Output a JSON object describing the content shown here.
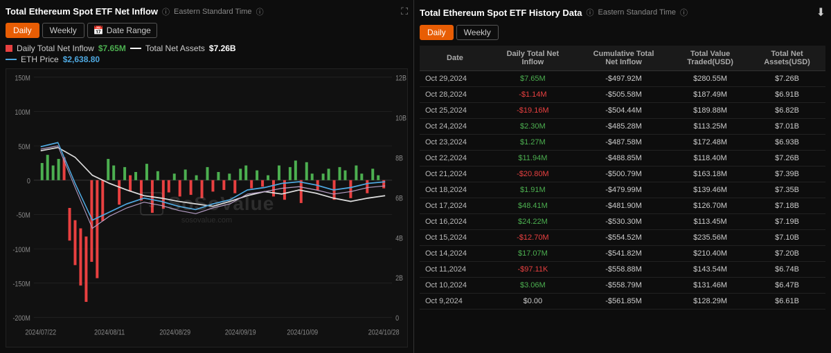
{
  "left": {
    "title": "Total Ethereum Spot ETF Net Inflow",
    "timezone": "Eastern Standard Time",
    "tabs": [
      "Daily",
      "Weekly"
    ],
    "active_tab": "Daily",
    "date_range_label": "Date Range",
    "legend": {
      "net_inflow_label": "Daily Total Net Inflow",
      "net_inflow_value": "$7.65M",
      "net_assets_label": "Total Net Assets",
      "net_assets_value": "$7.26B",
      "eth_price_label": "ETH Price",
      "eth_price_value": "$2,638.80"
    },
    "y_axis_left": [
      "150M",
      "100M",
      "50M",
      "0",
      "-50M",
      "-100M",
      "-150M",
      "-200M"
    ],
    "y_axis_right": [
      "12B",
      "10B",
      "8B",
      "6B",
      "4B",
      "2B",
      "0"
    ],
    "x_axis": [
      "2024/07/22",
      "2024/08/11",
      "2024/08/29",
      "2024/09/19",
      "2024/10/09",
      "2024/10/28"
    ],
    "watermark_logo": "SoSoValue",
    "watermark_url": "sosovalue.com"
  },
  "right": {
    "title": "Total Ethereum Spot ETF History Data",
    "timezone": "Eastern Standard Time",
    "tabs": [
      "Daily",
      "Weekly"
    ],
    "active_tab": "Daily",
    "columns": [
      "Date",
      "Daily Total Net Inflow",
      "Cumulative Total Net Inflow",
      "Total Value Traded(USD)",
      "Total Net Assets(USD)"
    ],
    "rows": [
      {
        "date": "Oct 29,2024",
        "daily": "$7.65M",
        "daily_class": "val-green",
        "cumulative": "-$497.92M",
        "cumulative_class": "val-white",
        "traded": "$280.55M",
        "assets": "$7.26B"
      },
      {
        "date": "Oct 28,2024",
        "daily": "-$1.14M",
        "daily_class": "val-red",
        "cumulative": "-$505.58M",
        "cumulative_class": "val-white",
        "traded": "$187.49M",
        "assets": "$6.91B"
      },
      {
        "date": "Oct 25,2024",
        "daily": "-$19.16M",
        "daily_class": "val-red",
        "cumulative": "-$504.44M",
        "cumulative_class": "val-white",
        "traded": "$189.88M",
        "assets": "$6.82B"
      },
      {
        "date": "Oct 24,2024",
        "daily": "$2.30M",
        "daily_class": "val-green",
        "cumulative": "-$485.28M",
        "cumulative_class": "val-white",
        "traded": "$113.25M",
        "assets": "$7.01B"
      },
      {
        "date": "Oct 23,2024",
        "daily": "$1.27M",
        "daily_class": "val-green",
        "cumulative": "-$487.58M",
        "cumulative_class": "val-white",
        "traded": "$172.48M",
        "assets": "$6.93B"
      },
      {
        "date": "Oct 22,2024",
        "daily": "$11.94M",
        "daily_class": "val-green",
        "cumulative": "-$488.85M",
        "cumulative_class": "val-white",
        "traded": "$118.40M",
        "assets": "$7.26B"
      },
      {
        "date": "Oct 21,2024",
        "daily": "-$20.80M",
        "daily_class": "val-red",
        "cumulative": "-$500.79M",
        "cumulative_class": "val-white",
        "traded": "$163.18M",
        "assets": "$7.39B"
      },
      {
        "date": "Oct 18,2024",
        "daily": "$1.91M",
        "daily_class": "val-green",
        "cumulative": "-$479.99M",
        "cumulative_class": "val-white",
        "traded": "$139.46M",
        "assets": "$7.35B"
      },
      {
        "date": "Oct 17,2024",
        "daily": "$48.41M",
        "daily_class": "val-green",
        "cumulative": "-$481.90M",
        "cumulative_class": "val-white",
        "traded": "$126.70M",
        "assets": "$7.18B"
      },
      {
        "date": "Oct 16,2024",
        "daily": "$24.22M",
        "daily_class": "val-green",
        "cumulative": "-$530.30M",
        "cumulative_class": "val-white",
        "traded": "$113.45M",
        "assets": "$7.19B"
      },
      {
        "date": "Oct 15,2024",
        "daily": "-$12.70M",
        "daily_class": "val-red",
        "cumulative": "-$554.52M",
        "cumulative_class": "val-white",
        "traded": "$235.56M",
        "assets": "$7.10B"
      },
      {
        "date": "Oct 14,2024",
        "daily": "$17.07M",
        "daily_class": "val-green",
        "cumulative": "-$541.82M",
        "cumulative_class": "val-white",
        "traded": "$210.40M",
        "assets": "$7.20B"
      },
      {
        "date": "Oct 11,2024",
        "daily": "-$97.11K",
        "daily_class": "val-red",
        "cumulative": "-$558.88M",
        "cumulative_class": "val-white",
        "traded": "$143.54M",
        "assets": "$6.74B"
      },
      {
        "date": "Oct 10,2024",
        "daily": "$3.06M",
        "daily_class": "val-green",
        "cumulative": "-$558.79M",
        "cumulative_class": "val-white",
        "traded": "$131.46M",
        "assets": "$6.47B"
      },
      {
        "date": "Oct 9,2024",
        "daily": "$0.00",
        "daily_class": "val-white",
        "cumulative": "-$561.85M",
        "cumulative_class": "val-white",
        "traded": "$128.29M",
        "assets": "$6.61B"
      }
    ]
  }
}
